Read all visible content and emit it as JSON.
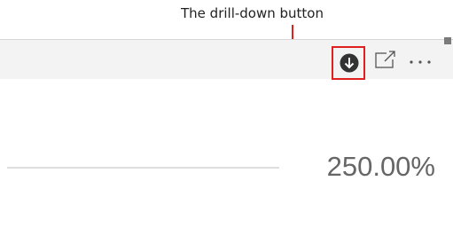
{
  "annotation": {
    "text": "The drill-down button",
    "color": "#e0201f"
  },
  "toolbar": {
    "drill_down_icon": "arrow-down-circle-icon",
    "focus_mode_icon": "focus-mode-icon",
    "more_options_icon": "more-options-icon"
  },
  "visual": {
    "value": "250.00%"
  }
}
